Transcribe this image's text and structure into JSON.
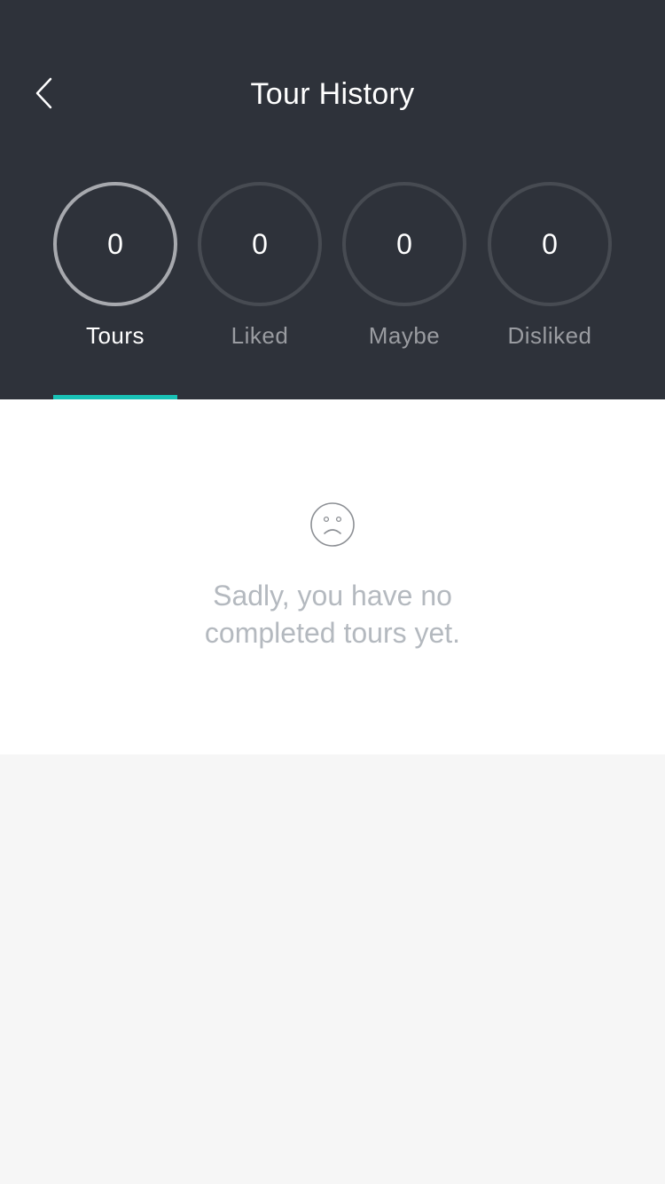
{
  "header": {
    "title": "Tour History",
    "back_icon": "chevron-left-icon"
  },
  "tabs": [
    {
      "count": "0",
      "label": "Tours",
      "active": true
    },
    {
      "count": "0",
      "label": "Liked",
      "active": false
    },
    {
      "count": "0",
      "label": "Maybe",
      "active": false
    },
    {
      "count": "0",
      "label": "Disliked",
      "active": false
    }
  ],
  "empty_state": {
    "icon": "sad-face-icon",
    "message_line1": "Sadly, you have no",
    "message_line2": "completed tours yet."
  },
  "colors": {
    "header_bg": "#2e323a",
    "accent": "#19c2b6",
    "page_bg": "#f6f6f6"
  }
}
